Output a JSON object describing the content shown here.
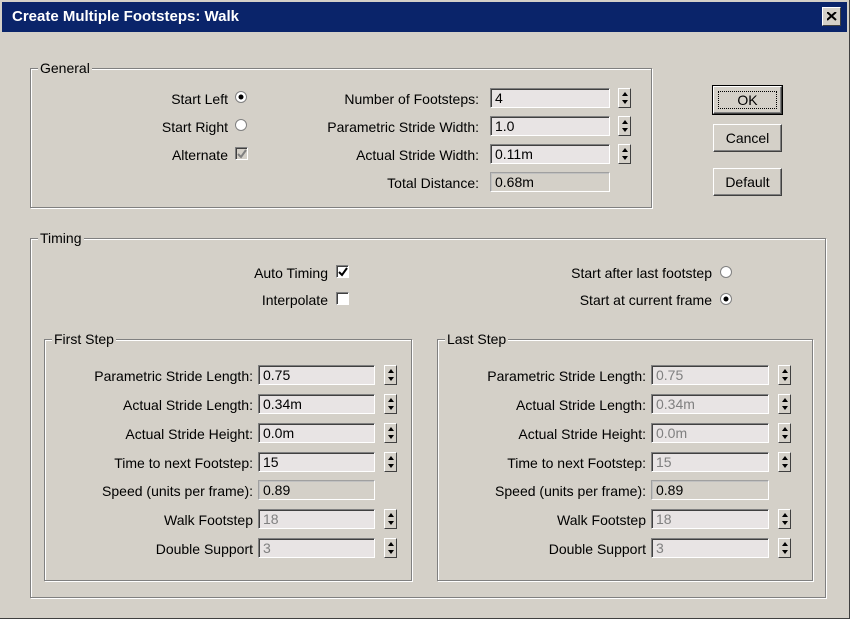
{
  "window": {
    "title": "Create Multiple Footsteps: Walk"
  },
  "general": {
    "label": "General",
    "start_left": {
      "label": "Start Left",
      "selected": true
    },
    "start_right": {
      "label": "Start Right",
      "selected": false
    },
    "alternate": {
      "label": "Alternate",
      "checked": true,
      "disabled": true
    },
    "number_of_footsteps": {
      "label": "Number of Footsteps:",
      "value": "4"
    },
    "parametric_stride_width": {
      "label": "Parametric Stride Width:",
      "value": "1.0"
    },
    "actual_stride_width": {
      "label": "Actual Stride Width:",
      "value": "0.11m"
    },
    "total_distance": {
      "label": "Total Distance:",
      "value": "0.68m"
    }
  },
  "buttons": {
    "ok": "OK",
    "cancel": "Cancel",
    "default": "Default"
  },
  "timing": {
    "label": "Timing",
    "auto_timing": {
      "label": "Auto Timing",
      "checked": true
    },
    "interpolate": {
      "label": "Interpolate",
      "checked": false
    },
    "start_after_last": {
      "label": "Start after last footstep",
      "selected": false
    },
    "start_at_current": {
      "label": "Start at current frame",
      "selected": true
    },
    "first_step": {
      "label": "First Step",
      "parametric_stride_length": {
        "label": "Parametric Stride Length:",
        "value": "0.75"
      },
      "actual_stride_length": {
        "label": "Actual Stride Length:",
        "value": "0.34m"
      },
      "actual_stride_height": {
        "label": "Actual Stride Height:",
        "value": "0.0m"
      },
      "time_to_next": {
        "label": "Time to next Footstep:",
        "value": "15"
      },
      "speed": {
        "label": "Speed (units per frame):",
        "value": "0.89"
      },
      "walk_footstep": {
        "label": "Walk Footstep",
        "value": "18"
      },
      "double_support": {
        "label": "Double Support",
        "value": "3"
      }
    },
    "last_step": {
      "label": "Last Step",
      "parametric_stride_length": {
        "label": "Parametric Stride Length:",
        "value": "0.75"
      },
      "actual_stride_length": {
        "label": "Actual Stride Length:",
        "value": "0.34m"
      },
      "actual_stride_height": {
        "label": "Actual Stride Height:",
        "value": "0.0m"
      },
      "time_to_next": {
        "label": "Time to next Footstep:",
        "value": "15"
      },
      "speed": {
        "label": "Speed (units per frame):",
        "value": "0.89"
      },
      "walk_footstep": {
        "label": "Walk Footstep",
        "value": "18"
      },
      "double_support": {
        "label": "Double Support",
        "value": "3"
      }
    }
  },
  "colors": {
    "titlebar": "#0a246a",
    "dialog_face": "#d4d0c8",
    "field_bg": "#e8e4e4"
  }
}
